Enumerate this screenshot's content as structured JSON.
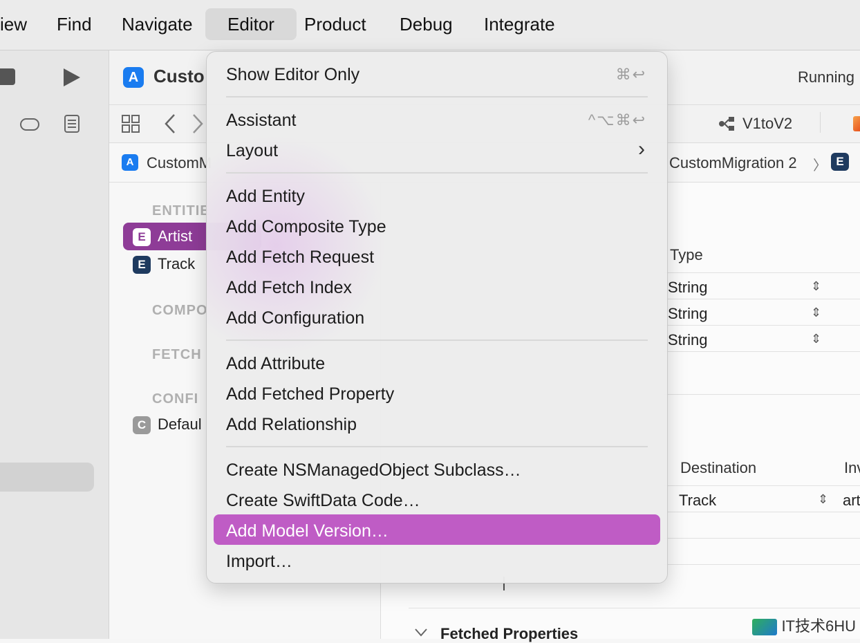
{
  "menubar": {
    "items": [
      {
        "label": "iew"
      },
      {
        "label": "Find"
      },
      {
        "label": "Navigate"
      },
      {
        "label": "Editor"
      },
      {
        "label": "Product"
      },
      {
        "label": "Debug"
      },
      {
        "label": "Integrate"
      }
    ]
  },
  "toolbar": {
    "project_title": "Custo",
    "status": "Running",
    "scheme": "V1toV2"
  },
  "jumpbar": {
    "left_crumb": "CustomM",
    "right_crumb": "CustomMigration 2",
    "chevron": "〉"
  },
  "outline": {
    "sections": {
      "entities": "ENTITIE",
      "composite": "COMPO",
      "fetch": "FETCH",
      "config": "CONFI"
    },
    "entities": [
      {
        "badge": "E",
        "label": "Artist"
      },
      {
        "badge": "E",
        "label": "Track"
      }
    ],
    "configurations": [
      {
        "badge": "C",
        "label": "Defaul"
      }
    ]
  },
  "editor": {
    "attributes_header": "Type",
    "attribute_types": [
      "String",
      "String",
      "String"
    ],
    "relationship_headers": {
      "destination": "Destination",
      "inverse": "Inv"
    },
    "relationship_row": {
      "destination": "Track",
      "inverse": "art"
    },
    "fetched_properties": "Fetched Properties"
  },
  "menu": {
    "show_editor_only": {
      "label": "Show Editor Only",
      "shortcut": "⌘↩"
    },
    "assistant": {
      "label": "Assistant",
      "shortcut": "^⌥⌘↩"
    },
    "layout": {
      "label": "Layout",
      "arrow": "›"
    },
    "add_entity": "Add Entity",
    "add_composite_type": "Add Composite Type",
    "add_fetch_request": "Add Fetch Request",
    "add_fetch_index": "Add Fetch Index",
    "add_configuration": "Add Configuration",
    "add_attribute": "Add Attribute",
    "add_fetched_property": "Add Fetched Property",
    "add_relationship": "Add Relationship",
    "create_nsmanagedobject_subclass": "Create NSManagedObject Subclass…",
    "create_swiftdata_code": "Create SwiftData Code…",
    "add_model_version": "Add Model Version…",
    "import": "Import…"
  },
  "colors": {
    "menu_highlight": "#bf5cc5",
    "selected_entity": "#8e3c97",
    "entity_badge": "#1e3a5f"
  },
  "watermark": "IT技术6HU"
}
